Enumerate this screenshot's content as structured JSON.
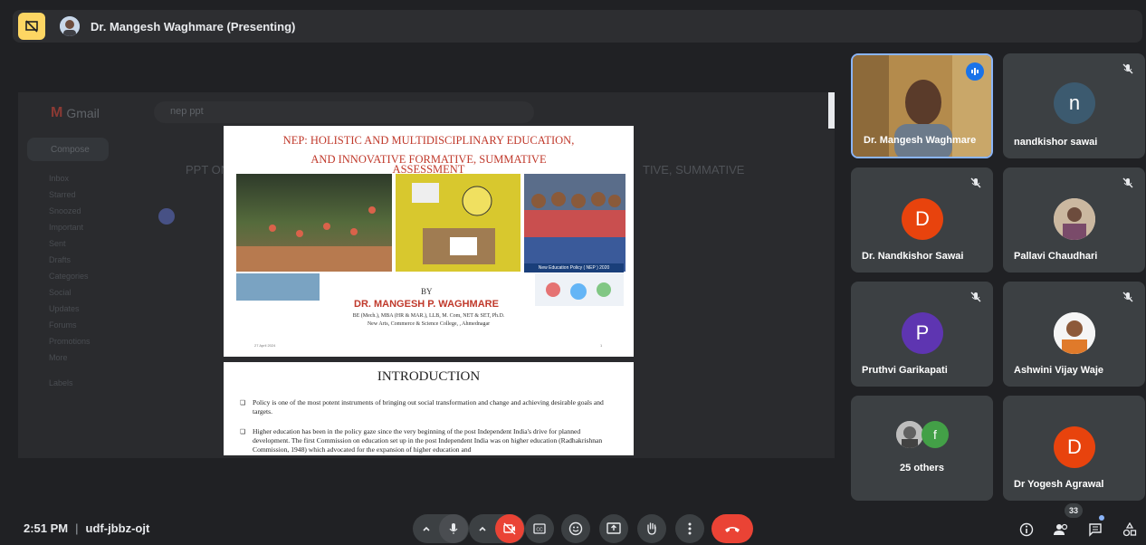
{
  "presenter_bar": {
    "label": "Dr. Mangesh Waghmare (Presenting)"
  },
  "shared_screen": {
    "gmail_brand": "Gmail",
    "search_text": "nep ppt",
    "compose_label": "Compose",
    "nav_items": [
      "Inbox",
      "Starred",
      "Snoozed",
      "Important",
      "Sent",
      "Drafts",
      "Categories",
      "Social",
      "Updates",
      "Forums",
      "Promotions",
      "More"
    ],
    "labels_heading": "Labels",
    "ghost_subject_left": "PPT ON ASSESS",
    "ghost_subject_right": "TIVE, SUMMATIVE",
    "slide1": {
      "title_line1": "NEP: HOLISTIC AND MULTIDISCIPLINARY EDUCATION,",
      "title_line2": "AND INNOVATIVE FORMATIVE, SUMMATIVE",
      "title_line3": "ASSESSMENT",
      "by": "BY",
      "author": "DR. MANGESH P. WAGHMARE",
      "qualifications": "BE (Mech.), MBA (HR & MAR.), LLB, M. Com, NET & SET, Ph.D.",
      "college": "New Arts, Commerce & Science College, , Ahmednagar",
      "date": "27 April 2024",
      "page": "1",
      "nep_banner": "New Education Policy ( NEP ) 2020"
    },
    "slide2": {
      "title": "INTRODUCTION",
      "bullet1": "Policy is one of the most potent instruments of bringing out social transformation and change and achieving desirable goals and targets.",
      "bullet2": "Higher education has been in the policy gaze since the very beginning of the post Independent India's drive for planned development. The first Commission on education set up in the post Independent India was on higher education (Radhakrishnan Commission, 1948) which advocated for the expansion of higher education and"
    }
  },
  "participants": [
    {
      "name": "Dr. Mangesh Waghmare",
      "type": "video",
      "speaking": true
    },
    {
      "name": "nandkishor sawai",
      "initial": "n",
      "color": "#3c5a6f",
      "muted": true
    },
    {
      "name": "Dr. Nandkishor Sawai",
      "initial": "D",
      "color": "#e8430d",
      "muted": true
    },
    {
      "name": "Pallavi Chaudhari",
      "type": "photo",
      "muted": true
    },
    {
      "name": "Pruthvi Garikapati",
      "initial": "P",
      "color": "#5e35b1",
      "muted": true
    },
    {
      "name": "Ashwini Vijay Waje",
      "type": "photo",
      "muted": true
    },
    {
      "name": "25 others",
      "type": "group",
      "second_initial": "f"
    },
    {
      "name": "Dr Yogesh Agrawal",
      "initial": "D",
      "color": "#e8430d"
    }
  ],
  "bottom_bar": {
    "time": "2:51 PM",
    "separator": "|",
    "meeting_code": "udf-jbbz-ojt",
    "people_count": "33"
  },
  "colors": {
    "background": "#202124",
    "tile": "#3c4043",
    "danger": "#ea4335",
    "accent": "#8ab4f8"
  }
}
